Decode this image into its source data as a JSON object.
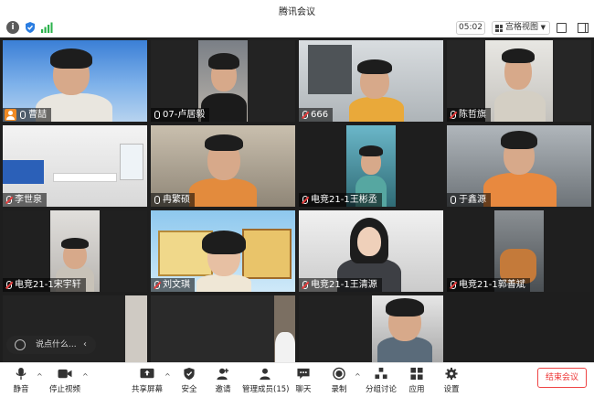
{
  "window": {
    "title": "腾讯会议"
  },
  "topbar": {
    "timer": "05:02",
    "view_mode": "宫格视图",
    "icons": [
      "info-icon",
      "shield-icon",
      "signal-icon",
      "fullscreen-icon",
      "sidebar-icon"
    ]
  },
  "participants": [
    {
      "name": "曹喆",
      "mic": "on",
      "host": true
    },
    {
      "name": "07-卢居毅",
      "mic": "on"
    },
    {
      "name": "666",
      "mic": "muted"
    },
    {
      "name": "陈哲旗",
      "mic": "muted"
    },
    {
      "name": "李世泉",
      "mic": "muted"
    },
    {
      "name": "冉繁硕",
      "mic": "on"
    },
    {
      "name": "电竞21-1王彬丞",
      "mic": "muted"
    },
    {
      "name": "于鑫源",
      "mic": "on"
    },
    {
      "name": "电竞21-1宋宇轩",
      "mic": "muted"
    },
    {
      "name": "刘文琪",
      "mic": "muted"
    },
    {
      "name": "电竞21-1王清源",
      "mic": "muted"
    },
    {
      "name": "电竞21-1郭善斌",
      "mic": "muted"
    }
  ],
  "chat": {
    "placeholder": "说点什么..."
  },
  "toolbar": {
    "mute": "静音",
    "stop_video": "停止视频",
    "share_screen": "共享屏幕",
    "security": "安全",
    "invite": "邀请",
    "participants": "管理成员(15)",
    "chat": "聊天",
    "record": "录制",
    "breakout": "分组讨论",
    "apps": "应用",
    "settings": "设置",
    "end": "结束会议"
  },
  "colors": {
    "accent": "#f08a24",
    "end_red": "#e33333",
    "stage_bg": "#1e1e1e"
  }
}
